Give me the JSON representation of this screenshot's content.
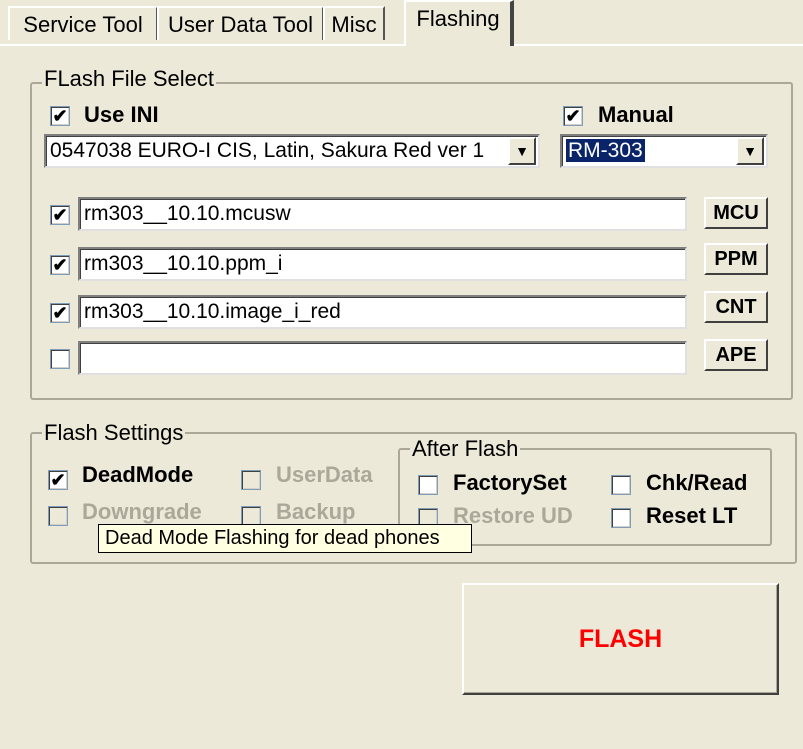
{
  "tabs": [
    "Service Tool",
    "User Data Tool",
    "Misc",
    "Flashing"
  ],
  "active_tab": "Flashing",
  "flash_file_select": {
    "legend": "FLash File Select",
    "use_ini": {
      "label": "Use INI",
      "checked": true
    },
    "manual": {
      "label": "Manual",
      "checked": true
    },
    "ini_combo_value": "0547038 EURO-I CIS, Latin, Sakura Red ver 1",
    "manual_combo_value": "RM-303",
    "files": [
      {
        "checked": true,
        "value": "rm303__10.10.mcusw",
        "button": "MCU"
      },
      {
        "checked": true,
        "value": "rm303__10.10.ppm_i",
        "button": "PPM"
      },
      {
        "checked": true,
        "value": "rm303__10.10.image_i_red",
        "button": "CNT"
      },
      {
        "checked": false,
        "value": "",
        "button": "APE"
      }
    ]
  },
  "flash_settings": {
    "legend": "Flash Settings",
    "deadmode": {
      "label": "DeadMode",
      "checked": true
    },
    "userdata": {
      "label": "UserData",
      "enabled": false
    },
    "downgrade": {
      "label": "Downgrade",
      "enabled": false
    },
    "backup": {
      "label": "Backup",
      "enabled": false
    }
  },
  "after_flash": {
    "legend": "After Flash",
    "factoryset": "FactorySet",
    "chkread": "Chk/Read",
    "restoreud": "Restore UD",
    "resetlt": "Reset LT"
  },
  "tooltip": "Dead Mode Flashing for dead phones",
  "flash_button": "FLASH",
  "icons": {
    "check": "✔",
    "dropdown": "▼"
  },
  "colors": {
    "flash_text": "#ff0000",
    "background": "#ece9d8",
    "selection": "#0a246a"
  }
}
